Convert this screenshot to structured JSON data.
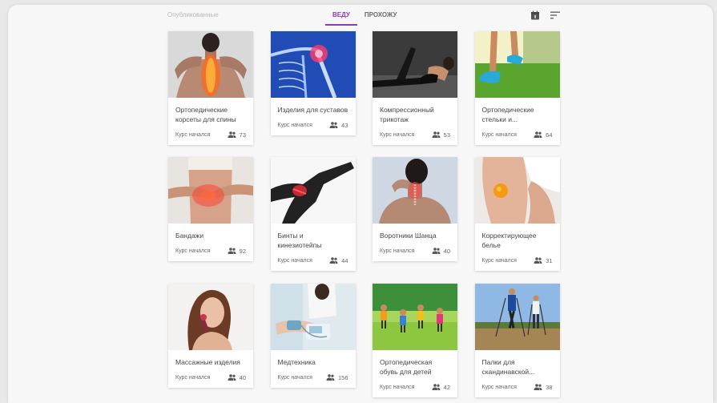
{
  "header": {
    "published_label": "Опубликованные",
    "tabs": [
      {
        "label": "Веду",
        "active": true
      },
      {
        "label": "Прохожу",
        "active": false
      }
    ],
    "calendar_icon": "calendar-icon",
    "sort_icon": "sort-icon"
  },
  "accent_color": "#8e3ab5",
  "courses": [
    {
      "title": "Ортопедические корсеты для спины",
      "status": "Курс начался",
      "count": "73",
      "image": "back-pain"
    },
    {
      "title": "Изделия для суставов",
      "status": "Курс начался",
      "count": "43",
      "image": "shoulder-xray"
    },
    {
      "title": "Компрессионный трикотаж",
      "status": "Курс начался",
      "count": "53",
      "image": "compression-legs"
    },
    {
      "title": "Ортопедические стельки и...",
      "status": "Курс начался",
      "count": "64",
      "image": "running-feet"
    },
    {
      "title": "Бандажи",
      "status": "Курс начался",
      "count": "92",
      "image": "abdomen-pain"
    },
    {
      "title": "Бинты и кинезиотейпы",
      "status": "Курс начался",
      "count": "44",
      "image": "runner-shoulder"
    },
    {
      "title": "Воротники Шанца",
      "status": "Курс начался",
      "count": "40",
      "image": "neck-pain"
    },
    {
      "title": "Корректирующее белье",
      "status": "Курс начался",
      "count": "31",
      "image": "orange-thigh"
    },
    {
      "title": "Массажные изделия",
      "status": "Курс начался",
      "count": "40",
      "image": "face-massager"
    },
    {
      "title": "Медтехника",
      "status": "Курс начался",
      "count": "156",
      "image": "blood-pressure"
    },
    {
      "title": "Ортопедическая обувь для детей",
      "status": "Курс начался",
      "count": "42",
      "image": "kids-running"
    },
    {
      "title": "Палки для скандинавской...",
      "status": "Курс начался",
      "count": "38",
      "image": "nordic-walking"
    }
  ]
}
